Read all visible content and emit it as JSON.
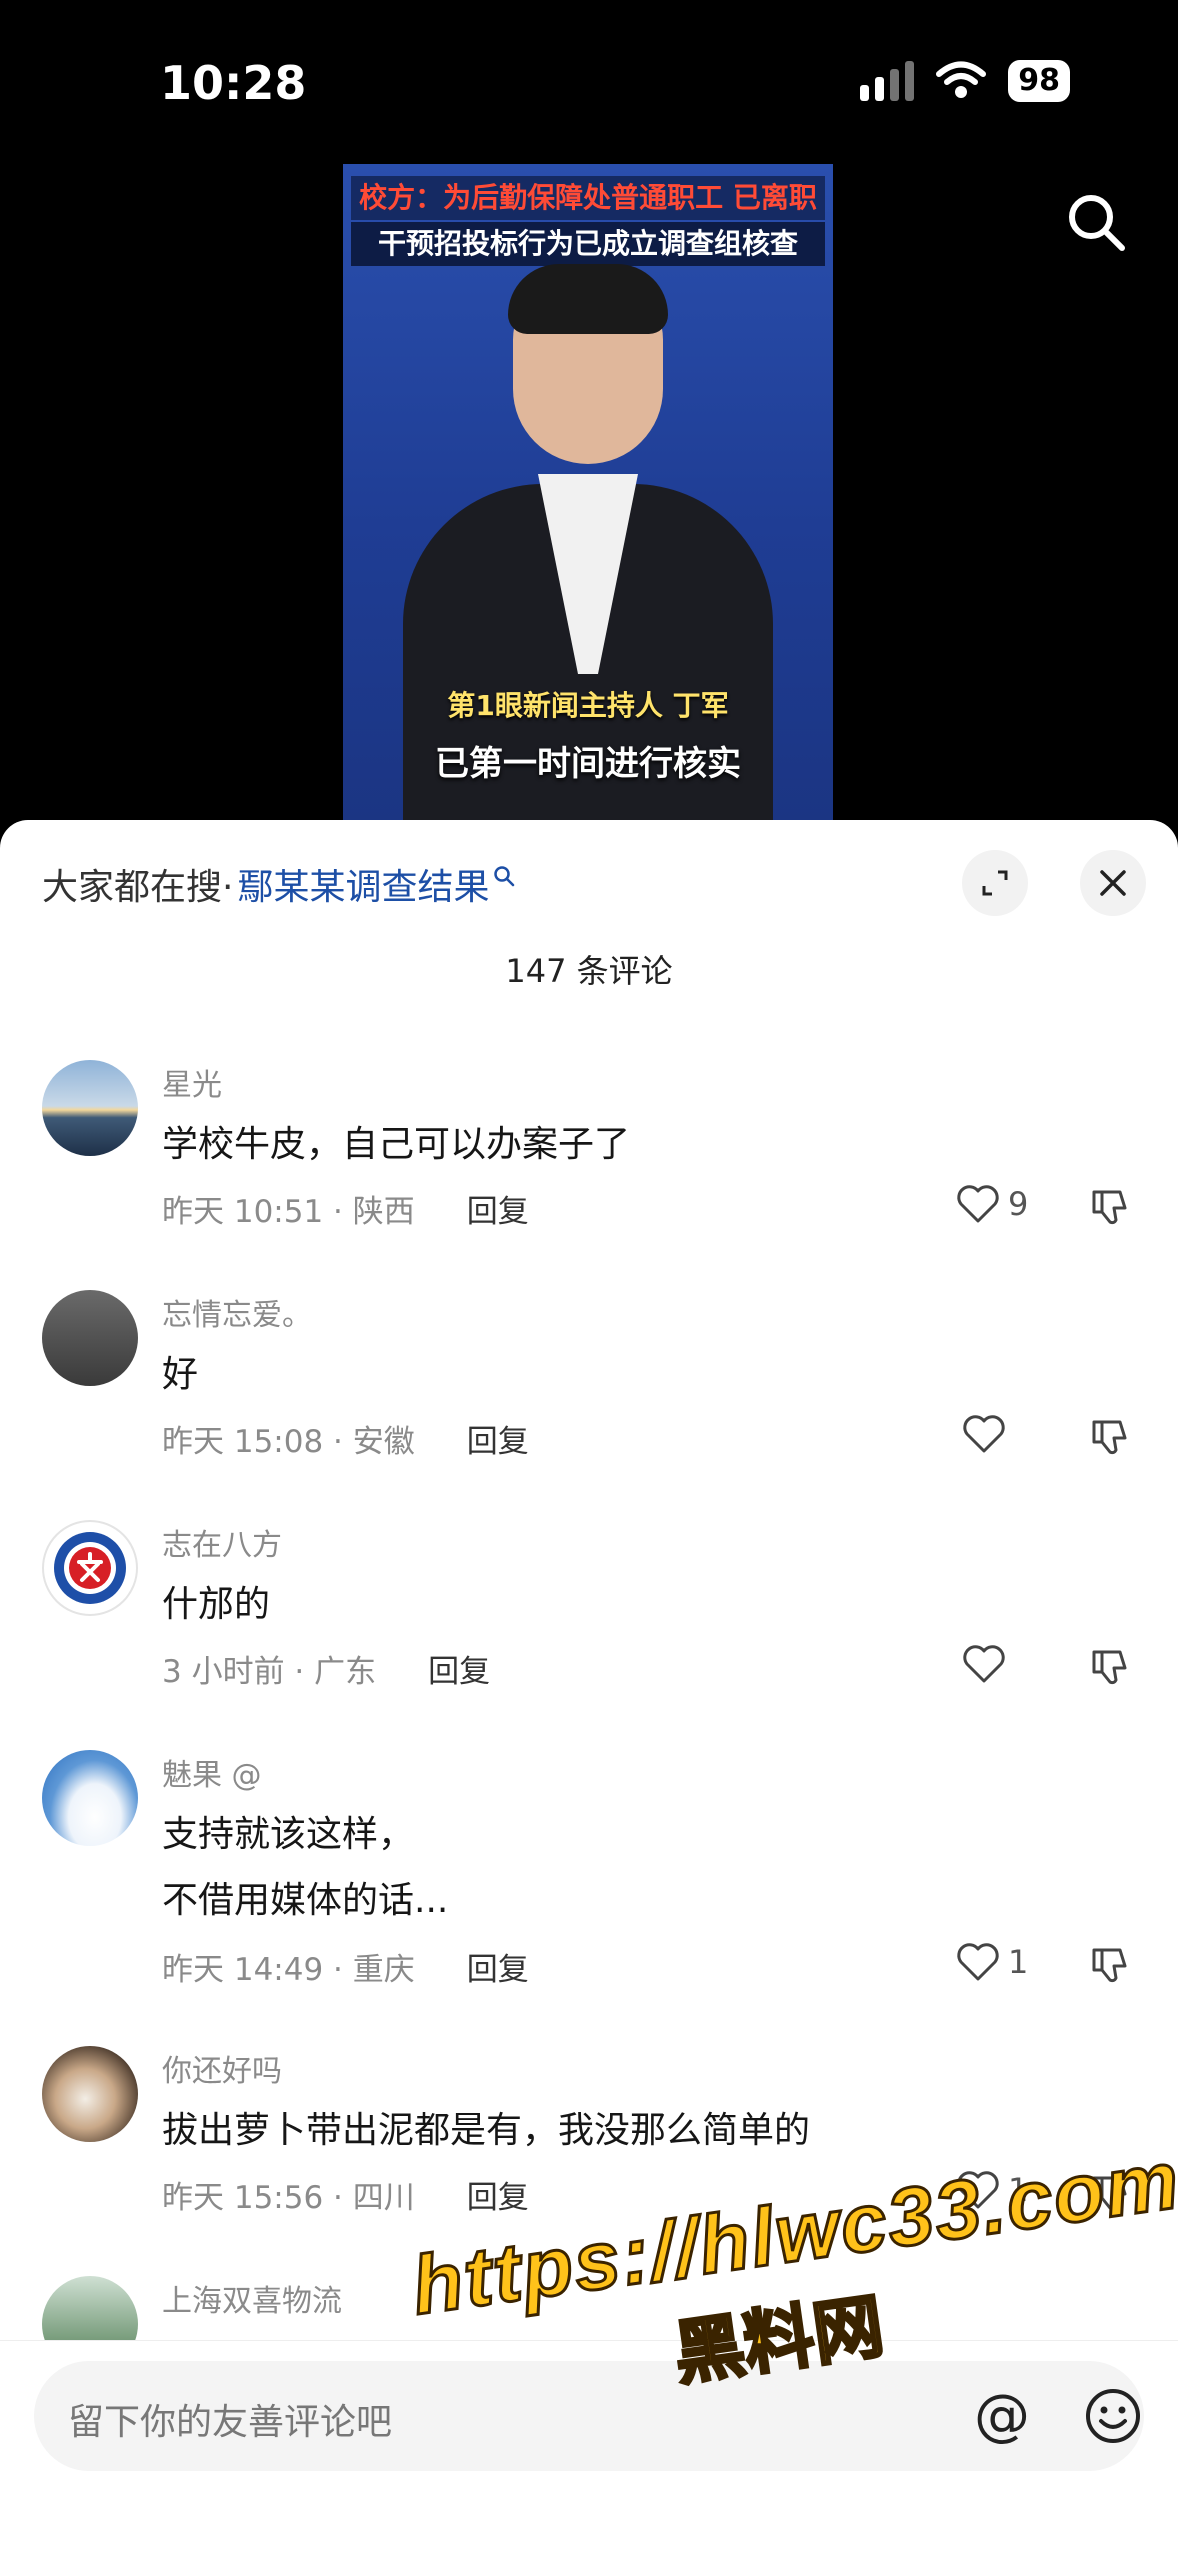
{
  "status_bar": {
    "time": "10:28",
    "battery": "98"
  },
  "video": {
    "headline_line1": "校方：为后勤保障处普通职工 已离职",
    "headline_line2": "干预招投标行为已成立调查组核查",
    "lower_third_name": "第1眼新闻主持人 丁军",
    "caption": "已第一时间进行核实"
  },
  "sheet": {
    "search_prefix": "大家都在搜·",
    "search_keyword": "鄢某某调查结果",
    "comment_count": "147 条评论"
  },
  "comments": [
    {
      "user": "星光",
      "text": "学校牛皮，自己可以办案子了",
      "meta": "昨天 10:51 · 陕西",
      "reply": "回复",
      "likes": "9"
    },
    {
      "user": "忘情忘爱。",
      "text": "好",
      "meta": "昨天 15:08 · 安徽",
      "reply": "回复",
      "likes": ""
    },
    {
      "user": "志在八方",
      "text": "什邡的",
      "meta": "3 小时前 · 广东",
      "reply": "回复",
      "likes": ""
    },
    {
      "user": "魅果 @",
      "text_line1": "支持就该这样，",
      "text_line2": "不借用媒体的话...",
      "meta": "昨天 14:49 · 重庆",
      "reply": "回复",
      "likes": "1"
    },
    {
      "user": "你还好吗",
      "text": "拔出萝卜带出泥都是有，我没那么简单的",
      "meta": "昨天 15:56 · 四川",
      "reply": "回复",
      "likes": "1"
    },
    {
      "user": "上海双喜物流"
    }
  ],
  "input": {
    "placeholder": "留下你的友善评论吧"
  },
  "watermark": {
    "url": "https://hlwc33.com",
    "name": "黑料网"
  },
  "colors": {
    "keyword": "#1d4fa6",
    "watermark": "#ffc21a"
  }
}
